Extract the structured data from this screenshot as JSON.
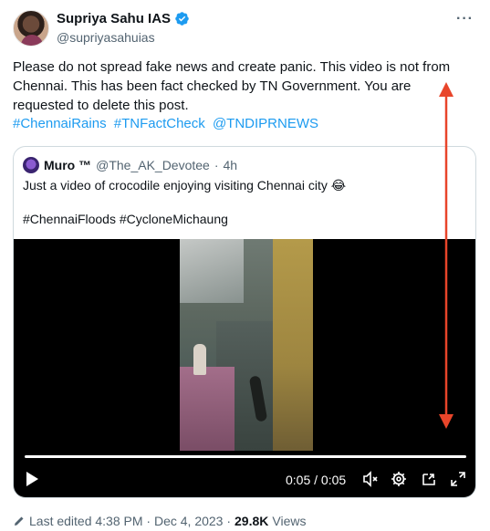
{
  "author": {
    "name": "Supriya Sahu IAS",
    "handle": "@supriyasahuias",
    "more_icon": "more-dots-icon",
    "verified_color": "#1d9bf0"
  },
  "tweet": {
    "text": "Please do not spread fake news and create panic. This video is not from Chennai. This has been fact checked by TN Government. You are requested to delete this post.",
    "hashtags": [
      "#ChennaiRains",
      "#TNFactCheck",
      "@TNDIPRNEWS"
    ]
  },
  "quote": {
    "name": "Muro ™",
    "handle": "@The_AK_Devotee",
    "separator": "·",
    "age": "4h",
    "text": "Just a video of crocodile enjoying visiting Chennai city 😂",
    "hashtags": "#ChennaiFloods #CycloneMichaung"
  },
  "video": {
    "time": "0:05 / 0:05",
    "progress": 1.0,
    "controls": [
      "play-icon",
      "mute-icon",
      "settings-icon",
      "picture-in-picture-icon",
      "fullscreen-icon"
    ]
  },
  "footer": {
    "edited": "Last edited 4:38 PM · Dec 4, 2023 ·",
    "views_count": "29.8K",
    "views_label": "Views"
  },
  "colors": {
    "link": "#1d9bf0",
    "annotation_arrow": "#e8452a",
    "muted": "#536471"
  }
}
